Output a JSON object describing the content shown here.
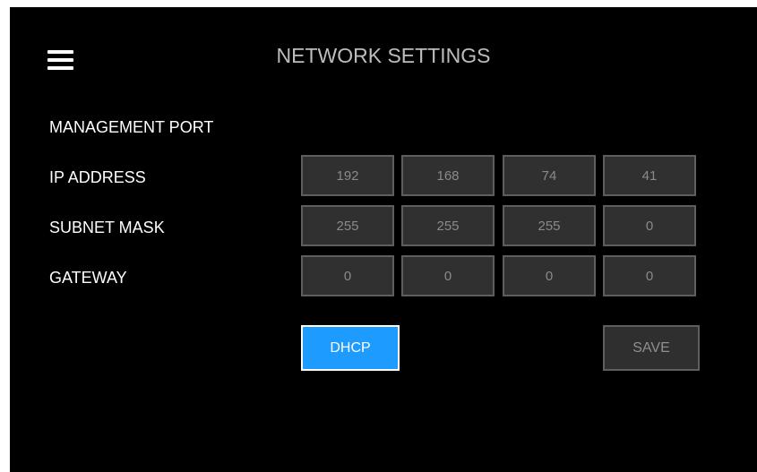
{
  "header": {
    "title": "NETWORK SETTINGS",
    "menu_icon": "hamburger-menu-icon"
  },
  "section": {
    "title": "MANAGEMENT PORT"
  },
  "fields": {
    "ip_address": {
      "label": "IP ADDRESS",
      "octets": [
        "192",
        "168",
        "74",
        "41"
      ]
    },
    "subnet_mask": {
      "label": "SUBNET MASK",
      "octets": [
        "255",
        "255",
        "255",
        "0"
      ]
    },
    "gateway": {
      "label": "GATEWAY",
      "octets": [
        "0",
        "0",
        "0",
        "0"
      ]
    }
  },
  "buttons": {
    "dhcp": "DHCP",
    "save": "SAVE"
  },
  "colors": {
    "background": "#000000",
    "accent": "#1e9bff",
    "field_background": "#303030",
    "field_border": "#5e5e5e",
    "field_text": "#8a8a8a",
    "title_text": "#bdbdbd"
  }
}
